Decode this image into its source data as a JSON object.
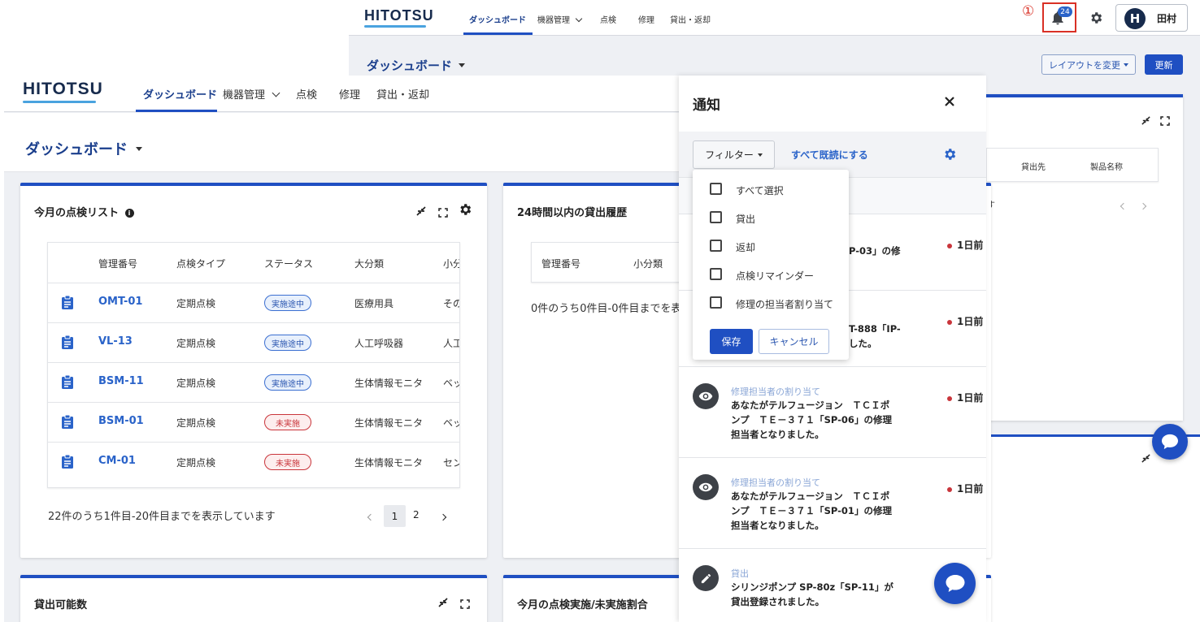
{
  "app": {
    "logo": "HITOTSU"
  },
  "nav": {
    "dashboard": "ダッシュボード",
    "equipment": "機器管理",
    "inspection": "点検",
    "repair": "修理",
    "lending": "貸出・返却"
  },
  "bg": {
    "annotation": "①",
    "notif_count": "24",
    "avatar_initial": "H",
    "user_name": "田村",
    "page_title": "ダッシュボード",
    "layout_button": "レイアウトを変更",
    "refresh_button": "更新",
    "table_headers": [
      "貸出先",
      "製品名称"
    ],
    "partial_text": "す"
  },
  "main": {
    "page_title": "ダッシュボード",
    "inspection_card": {
      "title": "今月の点検リスト",
      "headers": [
        "管理番号",
        "点検タイプ",
        "ステータス",
        "大分類",
        "小分"
      ],
      "rows": [
        {
          "id": "OMT-01",
          "type": "定期点検",
          "status": "実施途中",
          "status_kind": "blue",
          "category": "医療用具",
          "sub": "その"
        },
        {
          "id": "VL-13",
          "type": "定期点検",
          "status": "実施途中",
          "status_kind": "blue",
          "category": "人工呼吸器",
          "sub": "人工"
        },
        {
          "id": "BSM-11",
          "type": "定期点検",
          "status": "実施途中",
          "status_kind": "blue",
          "category": "生体情報モニタ",
          "sub": "ベッ"
        },
        {
          "id": "BSM-01",
          "type": "定期点検",
          "status": "未実施",
          "status_kind": "red",
          "category": "生体情報モニタ",
          "sub": "ベッ"
        },
        {
          "id": "CM-01",
          "type": "定期点検",
          "status": "未実施",
          "status_kind": "red",
          "category": "生体情報モニタ",
          "sub": "セン"
        }
      ],
      "pagination_text": "22件のうち1件目-20件目までを表示しています",
      "pages": [
        "1",
        "2"
      ]
    },
    "lending_card": {
      "title": "24時間以内の貸出履歴",
      "headers": [
        "管理番号",
        "小分類"
      ],
      "empty_text": "0件のうち0件目-0件目までを表"
    },
    "available_card": {
      "title": "貸出可能数"
    },
    "ratio_card": {
      "title": "今月の点検実施/未実施割合"
    }
  },
  "notifications": {
    "title": "通知",
    "filter_button": "フィルター",
    "mark_all_read": "すべて既読にする",
    "filter_menu": {
      "options": [
        "すべて選択",
        "貸出",
        "返却",
        "点検リマインダー",
        "修理の担当者割り当て"
      ],
      "save": "保存",
      "cancel": "キャンセル"
    },
    "items": [
      {
        "category": "",
        "line1": "P-03」の修",
        "line2": "",
        "line3": "",
        "time": "1日前"
      },
      {
        "category": "",
        "line1": "T-888「IP-",
        "line2": "した。",
        "line3": "",
        "time": "1日前"
      },
      {
        "category": "修理担当者の割り当て",
        "line1": "あなたがテルフュージョン　ＴＣＩポ",
        "line2": "ンプ　ＴＥ－３７１「SP-06」の修理",
        "line3": "担当者となりました。",
        "time": "1日前"
      },
      {
        "category": "修理担当者の割り当て",
        "line1": "あなたがテルフュージョン　ＴＣＩポ",
        "line2": "ンプ　ＴＥ－３７１「SP-01」の修理",
        "line3": "担当者となりました。",
        "time": "1日前"
      },
      {
        "category": "貸出",
        "line1": "シリンジポンプ SP-80z「SP-11」が",
        "line2": "貸出登録されました。",
        "line3": "",
        "time": ""
      }
    ]
  },
  "colors": {
    "accent": "#1f4fc2",
    "link": "#2a63c9",
    "danger": "#c9353b",
    "annotation": "#d93025"
  }
}
